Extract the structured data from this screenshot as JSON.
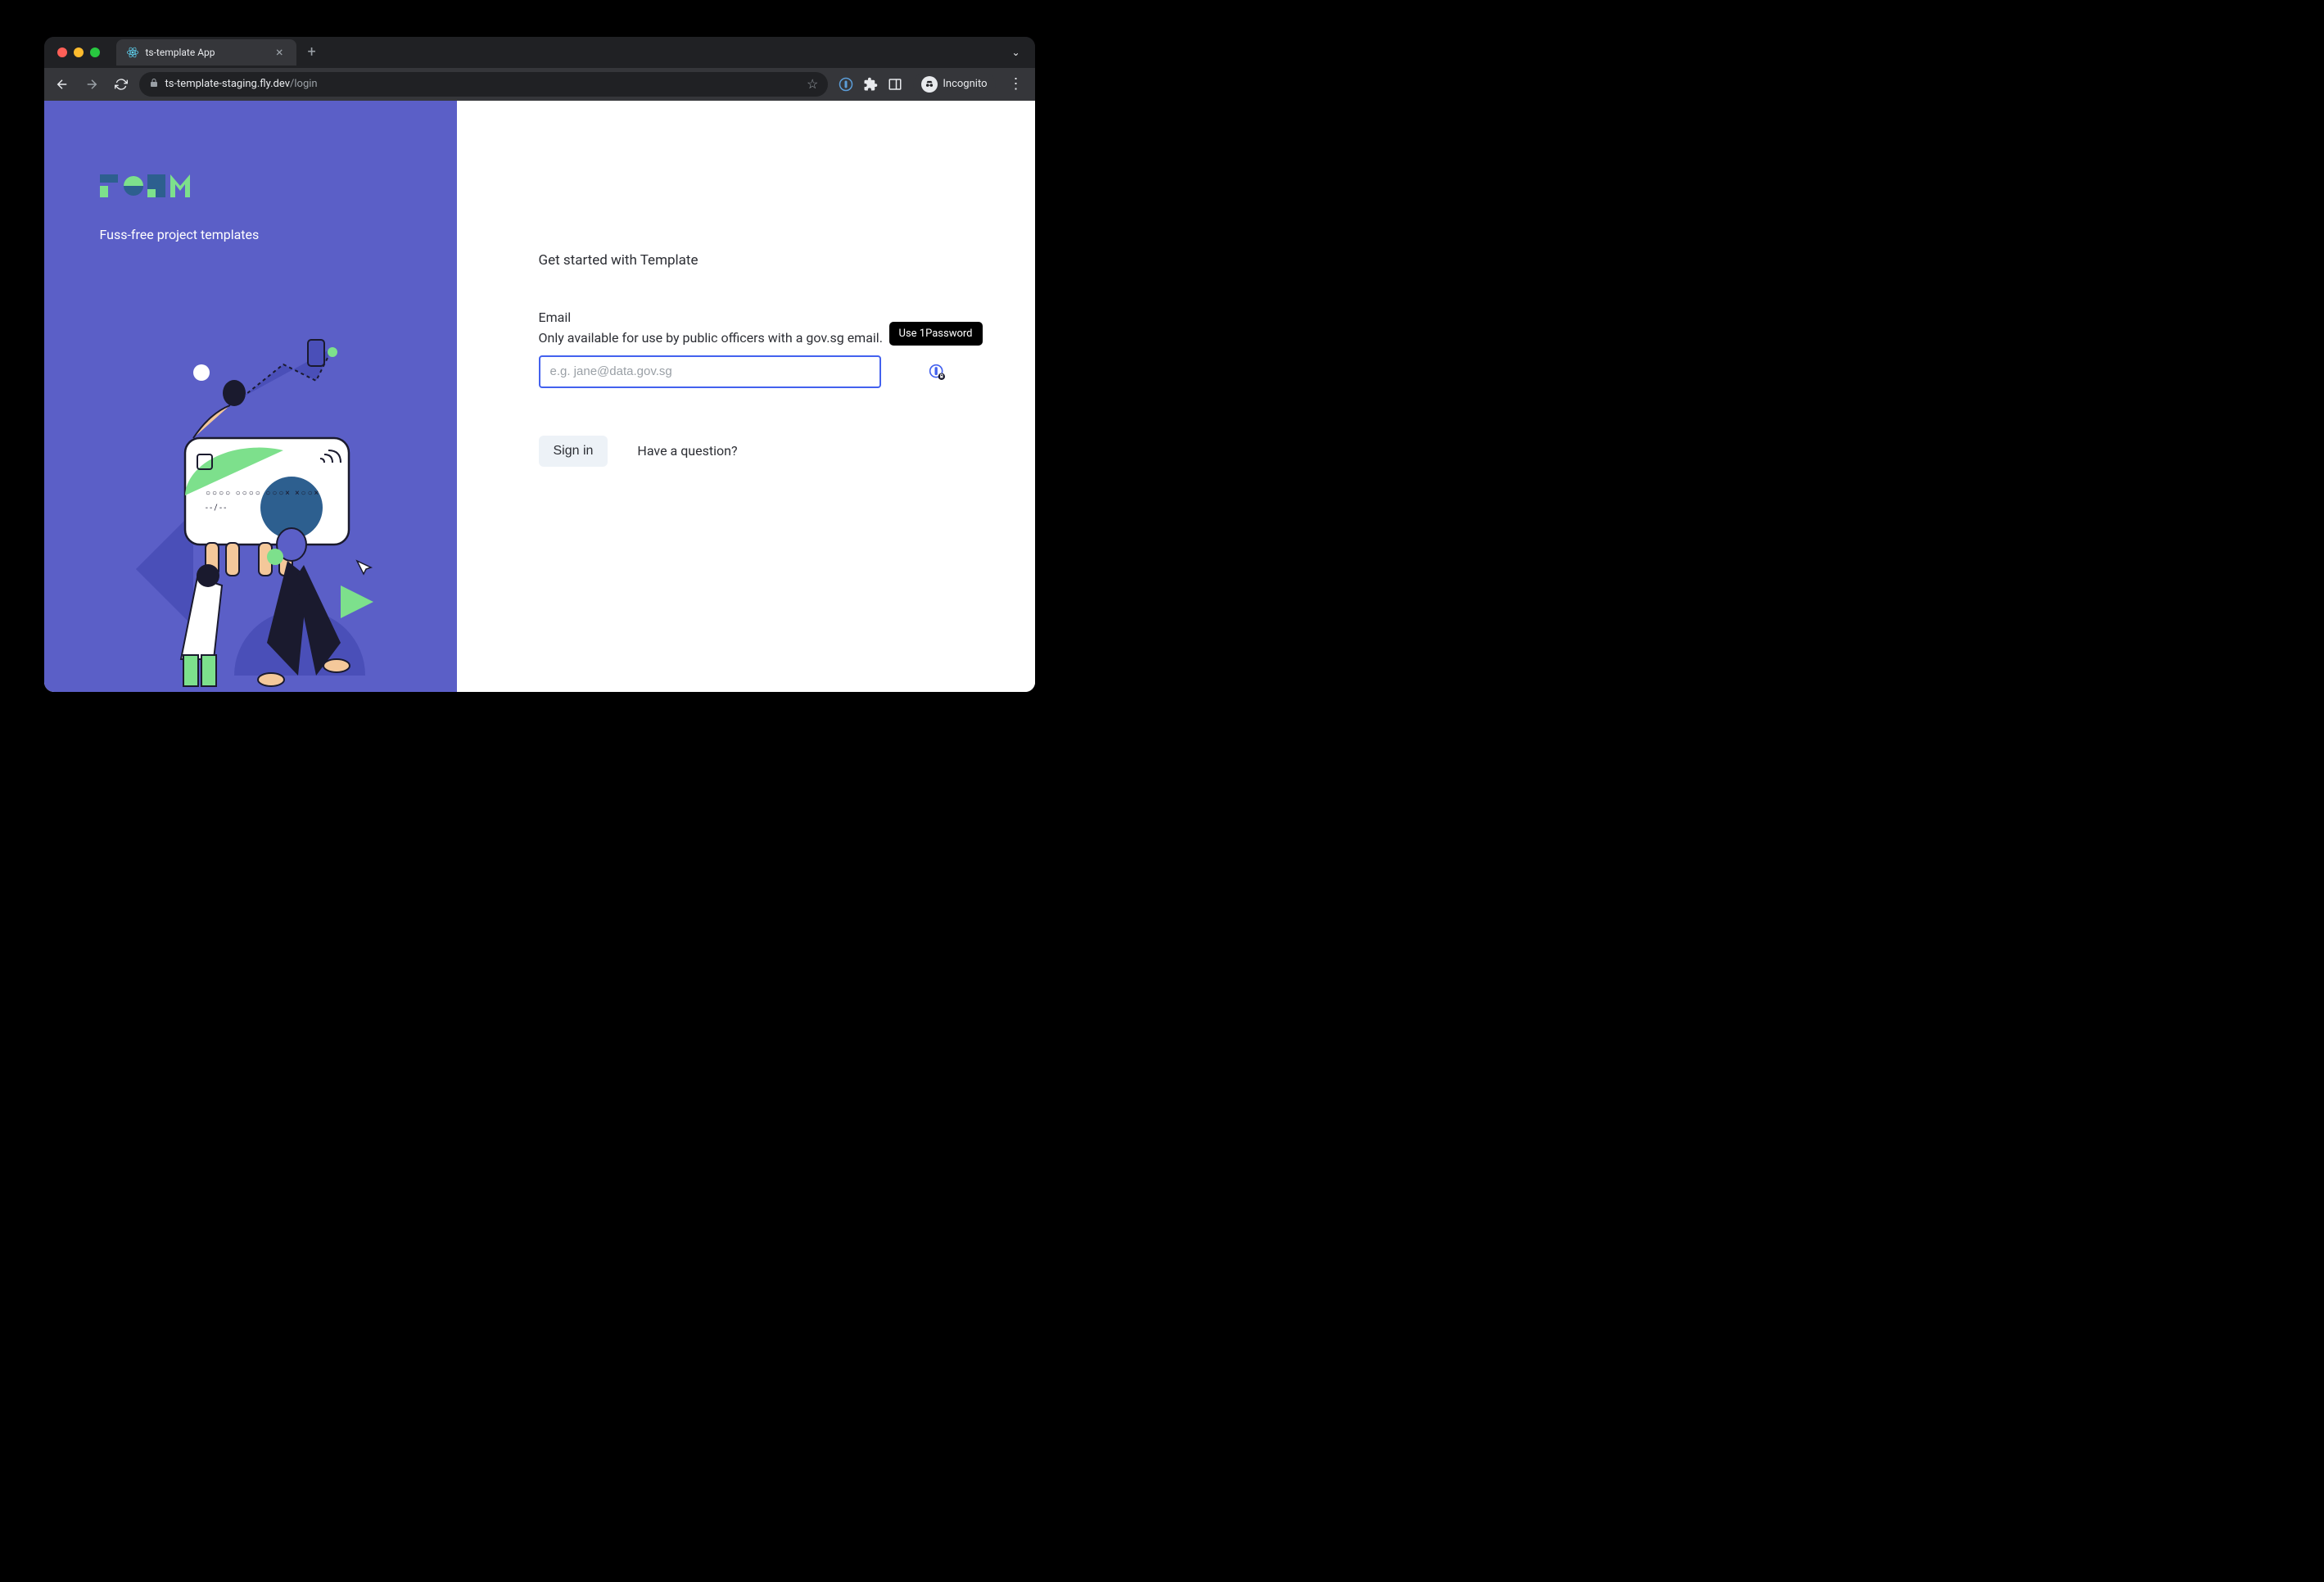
{
  "browser": {
    "tab_title": "ts-template App",
    "url_host": "ts-template-staging.fly.dev",
    "url_path": "/login",
    "incognito_label": "Incognito",
    "tab_menu": "⌄",
    "new_tab": "+",
    "tab_close": "×",
    "menu": "⋮"
  },
  "left": {
    "tagline": "Fuss-free project templates"
  },
  "login": {
    "heading": "Get started with Template",
    "email_label": "Email",
    "email_helper": "Only available for use by public officers with a gov.sg email.",
    "email_placeholder": "e.g. jane@data.gov.sg",
    "email_value": "",
    "tooltip": "Use 1Password",
    "signin_label": "Sign in",
    "question_link": "Have a question?"
  },
  "colors": {
    "left_bg": "#5b5fc7",
    "input_border": "#4361ee",
    "btn_bg": "#edf2f7"
  }
}
